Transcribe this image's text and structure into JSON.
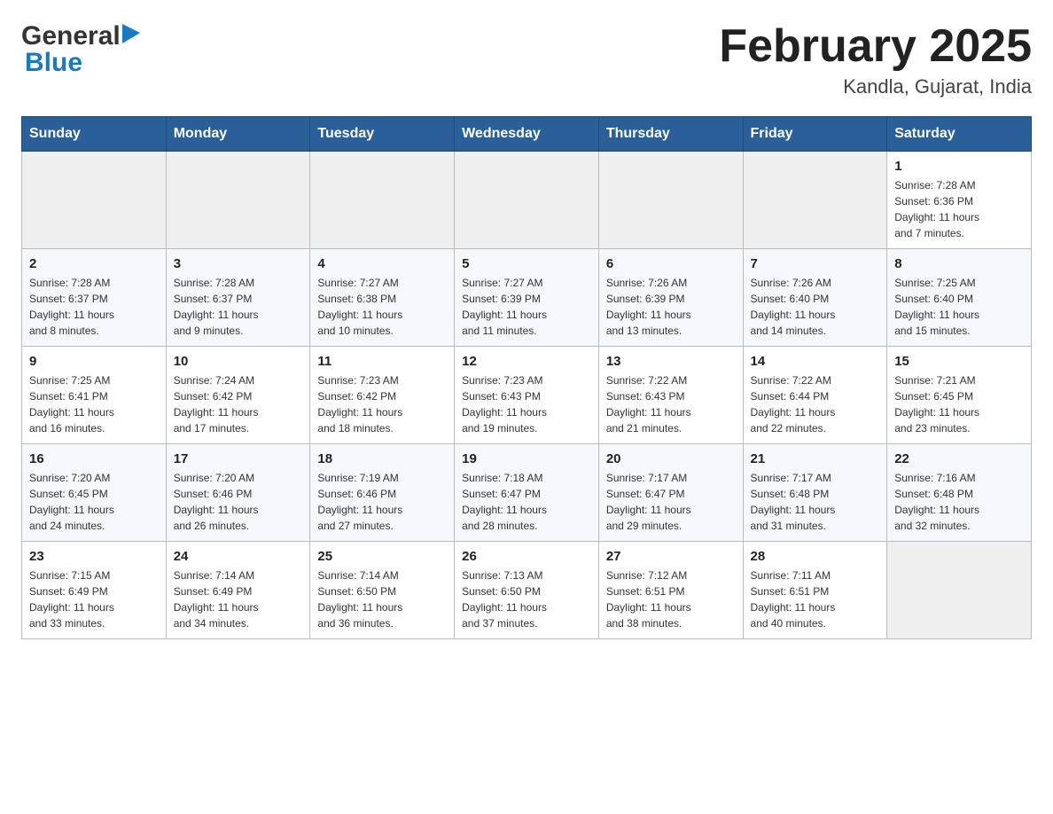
{
  "header": {
    "logo_general": "General",
    "logo_blue": "Blue",
    "month_title": "February 2025",
    "location": "Kandla, Gujarat, India"
  },
  "days_of_week": [
    "Sunday",
    "Monday",
    "Tuesday",
    "Wednesday",
    "Thursday",
    "Friday",
    "Saturday"
  ],
  "weeks": [
    [
      {
        "day": "",
        "info": ""
      },
      {
        "day": "",
        "info": ""
      },
      {
        "day": "",
        "info": ""
      },
      {
        "day": "",
        "info": ""
      },
      {
        "day": "",
        "info": ""
      },
      {
        "day": "",
        "info": ""
      },
      {
        "day": "1",
        "info": "Sunrise: 7:28 AM\nSunset: 6:36 PM\nDaylight: 11 hours\nand 7 minutes."
      }
    ],
    [
      {
        "day": "2",
        "info": "Sunrise: 7:28 AM\nSunset: 6:37 PM\nDaylight: 11 hours\nand 8 minutes."
      },
      {
        "day": "3",
        "info": "Sunrise: 7:28 AM\nSunset: 6:37 PM\nDaylight: 11 hours\nand 9 minutes."
      },
      {
        "day": "4",
        "info": "Sunrise: 7:27 AM\nSunset: 6:38 PM\nDaylight: 11 hours\nand 10 minutes."
      },
      {
        "day": "5",
        "info": "Sunrise: 7:27 AM\nSunset: 6:39 PM\nDaylight: 11 hours\nand 11 minutes."
      },
      {
        "day": "6",
        "info": "Sunrise: 7:26 AM\nSunset: 6:39 PM\nDaylight: 11 hours\nand 13 minutes."
      },
      {
        "day": "7",
        "info": "Sunrise: 7:26 AM\nSunset: 6:40 PM\nDaylight: 11 hours\nand 14 minutes."
      },
      {
        "day": "8",
        "info": "Sunrise: 7:25 AM\nSunset: 6:40 PM\nDaylight: 11 hours\nand 15 minutes."
      }
    ],
    [
      {
        "day": "9",
        "info": "Sunrise: 7:25 AM\nSunset: 6:41 PM\nDaylight: 11 hours\nand 16 minutes."
      },
      {
        "day": "10",
        "info": "Sunrise: 7:24 AM\nSunset: 6:42 PM\nDaylight: 11 hours\nand 17 minutes."
      },
      {
        "day": "11",
        "info": "Sunrise: 7:23 AM\nSunset: 6:42 PM\nDaylight: 11 hours\nand 18 minutes."
      },
      {
        "day": "12",
        "info": "Sunrise: 7:23 AM\nSunset: 6:43 PM\nDaylight: 11 hours\nand 19 minutes."
      },
      {
        "day": "13",
        "info": "Sunrise: 7:22 AM\nSunset: 6:43 PM\nDaylight: 11 hours\nand 21 minutes."
      },
      {
        "day": "14",
        "info": "Sunrise: 7:22 AM\nSunset: 6:44 PM\nDaylight: 11 hours\nand 22 minutes."
      },
      {
        "day": "15",
        "info": "Sunrise: 7:21 AM\nSunset: 6:45 PM\nDaylight: 11 hours\nand 23 minutes."
      }
    ],
    [
      {
        "day": "16",
        "info": "Sunrise: 7:20 AM\nSunset: 6:45 PM\nDaylight: 11 hours\nand 24 minutes."
      },
      {
        "day": "17",
        "info": "Sunrise: 7:20 AM\nSunset: 6:46 PM\nDaylight: 11 hours\nand 26 minutes."
      },
      {
        "day": "18",
        "info": "Sunrise: 7:19 AM\nSunset: 6:46 PM\nDaylight: 11 hours\nand 27 minutes."
      },
      {
        "day": "19",
        "info": "Sunrise: 7:18 AM\nSunset: 6:47 PM\nDaylight: 11 hours\nand 28 minutes."
      },
      {
        "day": "20",
        "info": "Sunrise: 7:17 AM\nSunset: 6:47 PM\nDaylight: 11 hours\nand 29 minutes."
      },
      {
        "day": "21",
        "info": "Sunrise: 7:17 AM\nSunset: 6:48 PM\nDaylight: 11 hours\nand 31 minutes."
      },
      {
        "day": "22",
        "info": "Sunrise: 7:16 AM\nSunset: 6:48 PM\nDaylight: 11 hours\nand 32 minutes."
      }
    ],
    [
      {
        "day": "23",
        "info": "Sunrise: 7:15 AM\nSunset: 6:49 PM\nDaylight: 11 hours\nand 33 minutes."
      },
      {
        "day": "24",
        "info": "Sunrise: 7:14 AM\nSunset: 6:49 PM\nDaylight: 11 hours\nand 34 minutes."
      },
      {
        "day": "25",
        "info": "Sunrise: 7:14 AM\nSunset: 6:50 PM\nDaylight: 11 hours\nand 36 minutes."
      },
      {
        "day": "26",
        "info": "Sunrise: 7:13 AM\nSunset: 6:50 PM\nDaylight: 11 hours\nand 37 minutes."
      },
      {
        "day": "27",
        "info": "Sunrise: 7:12 AM\nSunset: 6:51 PM\nDaylight: 11 hours\nand 38 minutes."
      },
      {
        "day": "28",
        "info": "Sunrise: 7:11 AM\nSunset: 6:51 PM\nDaylight: 11 hours\nand 40 minutes."
      },
      {
        "day": "",
        "info": ""
      }
    ]
  ]
}
